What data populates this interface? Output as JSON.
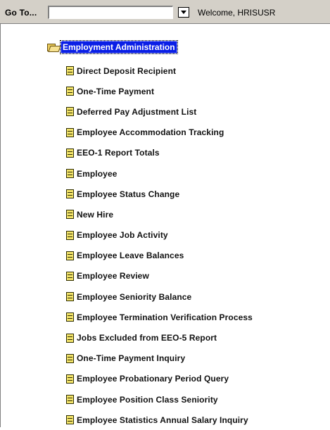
{
  "goto": {
    "label": "Go To...",
    "value": "",
    "placeholder": ""
  },
  "header": {
    "welcome": "Welcome, HRISUSR"
  },
  "tree": {
    "root": {
      "label": "Employment Administration",
      "icon": "folder-open-icon",
      "selected": true,
      "colors": {
        "selected_bg": "#0a1fe6",
        "selected_fg": "#ffffff"
      }
    },
    "items": [
      {
        "label": "Direct Deposit Recipient",
        "icon": "document-icon"
      },
      {
        "label": "One-Time Payment",
        "icon": "document-icon"
      },
      {
        "label": "Deferred Pay Adjustment List",
        "icon": "document-icon"
      },
      {
        "label": "Employee Accommodation Tracking",
        "icon": "document-icon"
      },
      {
        "label": "EEO-1 Report Totals",
        "icon": "document-icon"
      },
      {
        "label": "Employee",
        "icon": "document-icon"
      },
      {
        "label": "Employee Status Change",
        "icon": "document-icon"
      },
      {
        "label": "New Hire",
        "icon": "document-icon"
      },
      {
        "label": "Employee Job Activity",
        "icon": "document-icon"
      },
      {
        "label": "Employee Leave Balances",
        "icon": "document-icon"
      },
      {
        "label": "Employee Review",
        "icon": "document-icon"
      },
      {
        "label": "Employee Seniority Balance",
        "icon": "document-icon"
      },
      {
        "label": "Employee Termination  Verification Process",
        "icon": "document-icon"
      },
      {
        "label": "Jobs Excluded from EEO-5 Report",
        "icon": "document-icon"
      },
      {
        "label": "One-Time Payment Inquiry",
        "icon": "document-icon"
      },
      {
        "label": "Employee Probationary Period Query",
        "icon": "document-icon"
      },
      {
        "label": "Employee Position Class Seniority",
        "icon": "document-icon"
      },
      {
        "label": "Employee Statistics Annual Salary Inquiry",
        "icon": "document-icon"
      }
    ]
  }
}
